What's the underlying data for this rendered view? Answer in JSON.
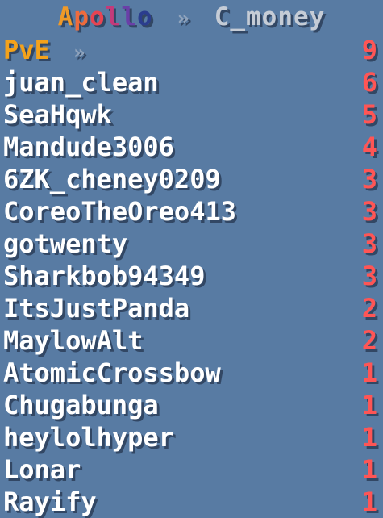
{
  "header": {
    "brand_letters": [
      {
        "char": "A",
        "color": "#f09a28"
      },
      {
        "char": "p",
        "color": "#ef6b3c"
      },
      {
        "char": "o",
        "color": "#e84452"
      },
      {
        "char": "l",
        "color": "#c43a7a"
      },
      {
        "char": "l",
        "color": "#6a3fa8"
      },
      {
        "char": "o",
        "color": "#2b3d8e"
      }
    ],
    "separator": "»",
    "server": "C_money"
  },
  "title_row": {
    "label": "PvE",
    "separator": "»",
    "value": "9"
  },
  "rows": [
    {
      "name": "juan_clean",
      "value": "6"
    },
    {
      "name": "SeaHqwk",
      "value": "5"
    },
    {
      "name": "Mandude3006",
      "value": "4"
    },
    {
      "name": "6ZK_cheney0209",
      "value": "3"
    },
    {
      "name": "CoreoTheOreo413",
      "value": "3"
    },
    {
      "name": "gotwenty",
      "value": "3"
    },
    {
      "name": "Sharkbob94349",
      "value": "3"
    },
    {
      "name": "ItsJustPanda",
      "value": "2"
    },
    {
      "name": "MaylowAlt",
      "value": "2"
    },
    {
      "name": "AtomicCrossbow",
      "value": "1"
    },
    {
      "name": "Chugabunga",
      "value": "1"
    },
    {
      "name": "heylolhyper",
      "value": "1"
    },
    {
      "name": "Lonar",
      "value": "1"
    },
    {
      "name": "Rayify",
      "value": "1"
    }
  ]
}
